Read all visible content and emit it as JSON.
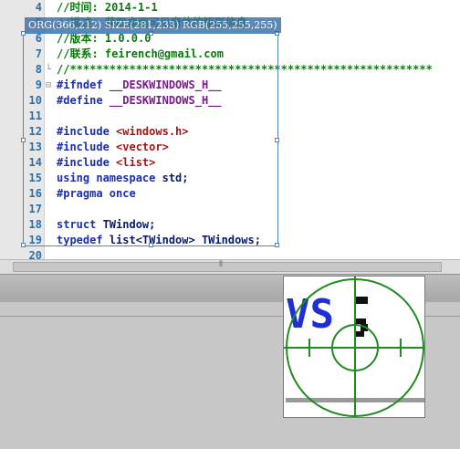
{
  "editor": {
    "lines": [
      {
        "num": "4",
        "fold": "",
        "tokens": [
          {
            "cls": "cmt",
            "text": "//时间: 2014-1-1"
          }
        ]
      },
      {
        "num": "5",
        "fold": "",
        "tokens": [
          {
            "cls": "cmt",
            "text": "//描述: 获取桌面可见窗体的矩形信息"
          }
        ]
      },
      {
        "num": "6",
        "fold": "",
        "tokens": [
          {
            "cls": "cmt",
            "text": "//版本: 1.0.0.0"
          }
        ]
      },
      {
        "num": "7",
        "fold": "",
        "tokens": [
          {
            "cls": "cmt",
            "text": "//联系: feirench@gmail.com"
          }
        ]
      },
      {
        "num": "8",
        "fold": "└",
        "tokens": [
          {
            "cls": "cmt",
            "text": "//*******************************************************"
          }
        ]
      },
      {
        "num": "9",
        "fold": "⊟",
        "tokens": [
          {
            "cls": "kw",
            "text": "#ifndef "
          },
          {
            "cls": "mac",
            "text": "__DESKWINDOWS_H__"
          }
        ]
      },
      {
        "num": "10",
        "fold": "",
        "tokens": [
          {
            "cls": "kw",
            "text": "#define "
          },
          {
            "cls": "mac",
            "text": "__DESKWINDOWS_H__"
          }
        ]
      },
      {
        "num": "11",
        "fold": "",
        "tokens": []
      },
      {
        "num": "12",
        "fold": "",
        "tokens": [
          {
            "cls": "kw",
            "text": "#include "
          },
          {
            "cls": "str",
            "text": "<windows.h>"
          }
        ]
      },
      {
        "num": "13",
        "fold": "",
        "tokens": [
          {
            "cls": "kw",
            "text": "#include "
          },
          {
            "cls": "str",
            "text": "<vector>"
          }
        ]
      },
      {
        "num": "14",
        "fold": "",
        "tokens": [
          {
            "cls": "kw",
            "text": "#include "
          },
          {
            "cls": "str",
            "text": "<list>"
          }
        ]
      },
      {
        "num": "15",
        "fold": "",
        "tokens": [
          {
            "cls": "kw",
            "text": "using namespace "
          },
          {
            "cls": "txt",
            "text": "std;"
          }
        ]
      },
      {
        "num": "16",
        "fold": "",
        "tokens": [
          {
            "cls": "kw",
            "text": "#pragma once"
          }
        ]
      },
      {
        "num": "17",
        "fold": "",
        "tokens": []
      },
      {
        "num": "18",
        "fold": "",
        "tokens": [
          {
            "cls": "kw",
            "text": "struct "
          },
          {
            "cls": "txt",
            "text": "TWindow;"
          }
        ]
      },
      {
        "num": "19",
        "fold": "",
        "tokens": [
          {
            "cls": "kw",
            "text": "typedef "
          },
          {
            "cls": "txt",
            "text": "list<TWindow> TWindows;"
          }
        ]
      },
      {
        "num": "20",
        "fold": "",
        "tokens": []
      }
    ]
  },
  "overlay": {
    "info_text": "ORG(366,212) SIZE(281,233) RGB(255,255,255)"
  },
  "scrollbar": {
    "grip": "⦀"
  },
  "magnifier": {
    "zoomed_text": "VS",
    "circle_color": "#1e8c1e",
    "text_color": "#1f2fd6"
  }
}
